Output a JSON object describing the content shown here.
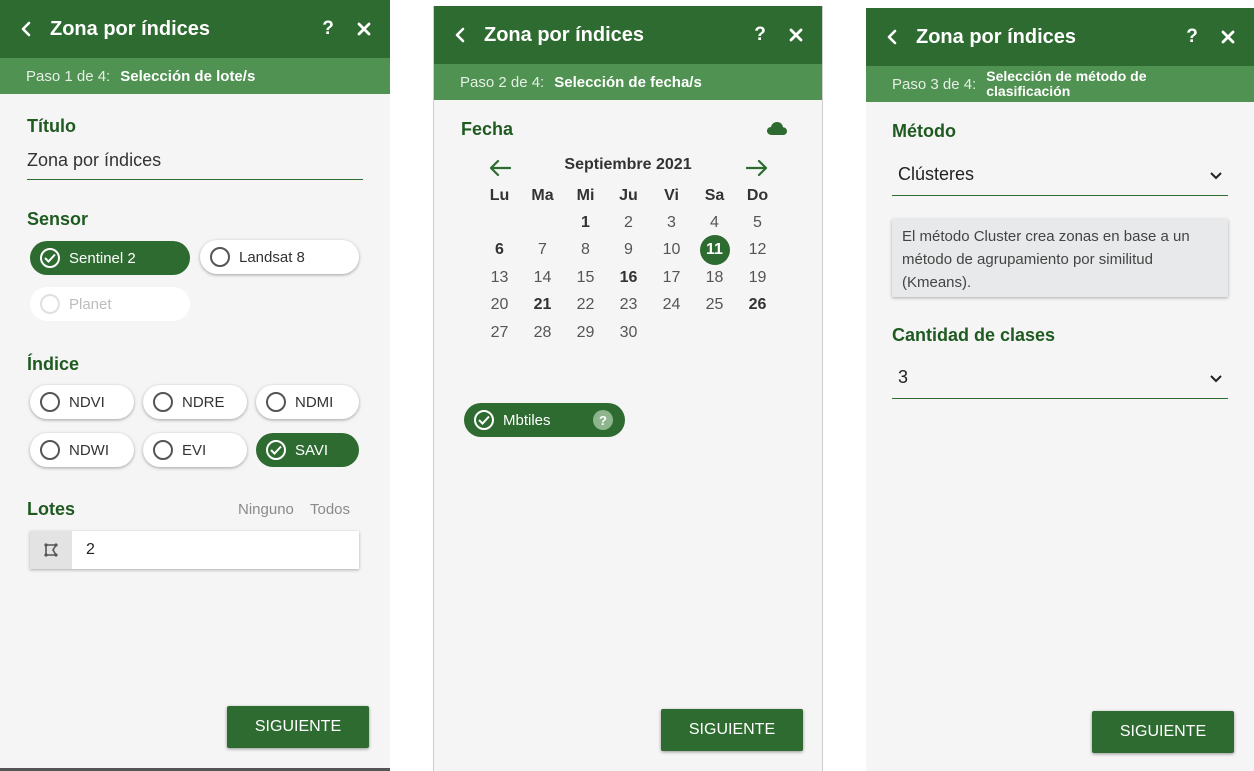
{
  "panels": [
    {
      "header": {
        "title": "Zona por índices",
        "help": "?"
      },
      "step": {
        "num": "Paso 1 de 4:",
        "name": "Selección de lote/s"
      },
      "titulo": {
        "label": "Título",
        "value": "Zona por índices"
      },
      "sensor": {
        "label": "Sensor",
        "options": [
          "Sentinel 2",
          "Landsat 8",
          "Planet"
        ],
        "selected": "Sentinel 2",
        "disabled": "Planet"
      },
      "indice": {
        "label": "Índice",
        "options": [
          "NDVI",
          "NDRE",
          "NDMI",
          "NDWI",
          "EVI",
          "SAVI"
        ],
        "selected": "SAVI"
      },
      "lotes": {
        "label": "Lotes",
        "none": "Ninguno",
        "all": "Todos",
        "value": "2"
      },
      "button": "SIGUIENTE"
    },
    {
      "header": {
        "title": "Zona por índices",
        "help": "?"
      },
      "step": {
        "num": "Paso 2 de 4:",
        "name": "Selección de fecha/s"
      },
      "fecha": {
        "label": "Fecha"
      },
      "calendar": {
        "month": "Septiembre 2021",
        "weekdays": [
          "Lu",
          "Ma",
          "Mi",
          "Ju",
          "Vi",
          "Sa",
          "Do"
        ],
        "days": [
          "",
          "",
          "1",
          "2",
          "3",
          "4",
          "5",
          "6",
          "7",
          "8",
          "9",
          "10",
          "11",
          "12",
          "13",
          "14",
          "15",
          "16",
          "17",
          "18",
          "19",
          "20",
          "21",
          "22",
          "23",
          "24",
          "25",
          "26",
          "27",
          "28",
          "29",
          "30"
        ],
        "bold_days": [
          "1",
          "6",
          "16",
          "21",
          "26"
        ],
        "selected_day": "11"
      },
      "mbtiles": {
        "label": "Mbtiles",
        "help": "?"
      },
      "button": "SIGUIENTE"
    },
    {
      "header": {
        "title": "Zona por índices",
        "help": "?"
      },
      "step": {
        "num": "Paso 3 de 4:",
        "name_line1": "Selección de método de",
        "name_line2": "clasificación"
      },
      "metodo": {
        "label": "Método",
        "value": "Clústeres"
      },
      "note": "El método Cluster crea zonas en base a un método de agrupamiento por similitud (Kmeans).",
      "clases": {
        "label": "Cantidad de clases",
        "value": "3"
      },
      "button": "SIGUIENTE"
    }
  ],
  "colors": {
    "primary": "#2e6b30",
    "step_bar": "#4f9251",
    "section_title": "#1f5a21"
  },
  "icons": [
    "back-arrow-icon",
    "close-icon",
    "check-circle-icon",
    "radio-empty-icon",
    "polygon-icon",
    "arrow-left-icon",
    "arrow-right-icon",
    "cloud-icon",
    "chevron-down-icon"
  ]
}
